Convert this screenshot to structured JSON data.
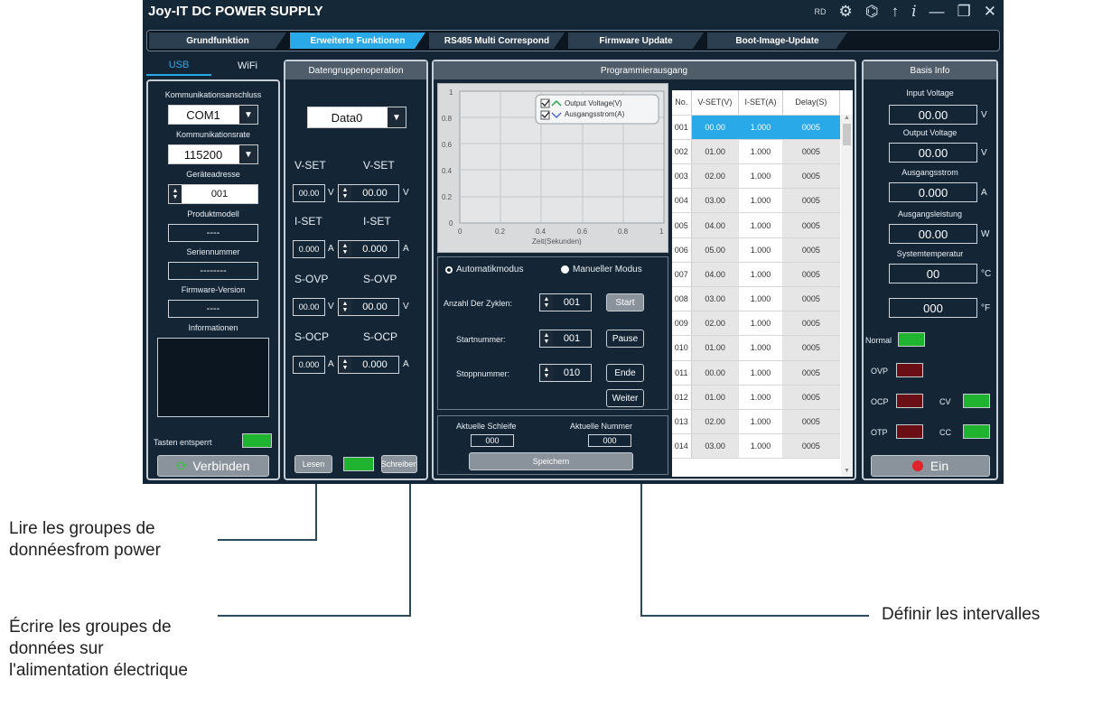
{
  "window": {
    "title": "Joy-IT DC POWER SUPPLY",
    "rd_label": "RD"
  },
  "tabs": [
    {
      "label": "Grundfunktion"
    },
    {
      "label": "Erweiterte Funktionen"
    },
    {
      "label": "RS485 Multi Correspond"
    },
    {
      "label": "Firmware Update"
    },
    {
      "label": "Boot-Image-Update"
    }
  ],
  "left": {
    "tab_usb": "USB",
    "tab_wifi": "WiFi",
    "port_label": "Kommunikationsanschluss",
    "port_value": "COM1",
    "rate_label": "Kommunikationsrate",
    "rate_value": "115200",
    "addr_label": "Geräteadresse",
    "addr_value": "001",
    "model_label": "Produktmodell",
    "model_value": "----",
    "serial_label": "Seriennummer",
    "serial_value": "--------",
    "fw_label": "Firmware-Version",
    "fw_value": "----",
    "info_label": "Informationen",
    "keys_label": "Tasten entsperrt",
    "connect_button": "Verbinden"
  },
  "group": {
    "header": "Datengruppenoperation",
    "select_value": "Data0",
    "vset_l": "V-SET",
    "vset_r": "V-SET",
    "vset_val1": "00.00",
    "vset_val2": "00.00",
    "vset_unit": "V",
    "iset_l": "I-SET",
    "iset_r": "I-SET",
    "iset_val1": "0.000",
    "iset_val2": "0.000",
    "iset_unit": "A",
    "sovp_l": "S-OVP",
    "sovp_r": "S-OVP",
    "sovp_val1": "00.00",
    "sovp_val2": "00.00",
    "sovp_unit": "V",
    "socp_l": "S-OCP",
    "socp_r": "S-OCP",
    "socp_val1": "0.000",
    "socp_val2": "0.000",
    "socp_unit": "A",
    "read_button": "Lesen",
    "write_button": "Schreiben"
  },
  "prog": {
    "header": "Programmierausgang",
    "legend_1": "Output Voltage(V)",
    "legend_2": "Ausgangsstrom(A)",
    "xlabel": "Zeit(Sekunden)",
    "x_ticks": [
      "0",
      "0.2",
      "0.4",
      "0.6",
      "0.8",
      "1"
    ],
    "y_ticks": [
      "1",
      "0.8",
      "0.6",
      "0.4",
      "0.2",
      "0"
    ],
    "mode_auto": "Automatikmodus",
    "mode_manual": "Manueller Modus",
    "cycles_label": "Anzahl Der Zyklen:",
    "cycles_value": "001",
    "start_label": "Startnummer:",
    "start_value": "001",
    "stop_label": "Stoppnummer:",
    "stop_value": "010",
    "btn_start": "Start",
    "btn_pause": "Pause",
    "btn_end": "Ende",
    "btn_next": "Weiter",
    "loop_label": "Aktuelle Schleife",
    "loop_value": "000",
    "num_label": "Aktuelle Nummer",
    "num_value": "000",
    "save_button": "Speichern",
    "table_headers": [
      "No.",
      "V-SET(V)",
      "I-SET(A)",
      "Delay(S)"
    ],
    "rows": [
      [
        "001",
        "00.00",
        "1.000",
        "0005"
      ],
      [
        "002",
        "01.00",
        "1.000",
        "0005"
      ],
      [
        "003",
        "02.00",
        "1.000",
        "0005"
      ],
      [
        "004",
        "03.00",
        "1.000",
        "0005"
      ],
      [
        "005",
        "04.00",
        "1.000",
        "0005"
      ],
      [
        "006",
        "05.00",
        "1.000",
        "0005"
      ],
      [
        "007",
        "04.00",
        "1.000",
        "0005"
      ],
      [
        "008",
        "03.00",
        "1.000",
        "0005"
      ],
      [
        "009",
        "02.00",
        "1.000",
        "0005"
      ],
      [
        "010",
        "01.00",
        "1.000",
        "0005"
      ],
      [
        "011",
        "00.00",
        "1.000",
        "0005"
      ],
      [
        "012",
        "01.00",
        "1.000",
        "0005"
      ],
      [
        "013",
        "02.00",
        "1.000",
        "0005"
      ],
      [
        "014",
        "03.00",
        "1.000",
        "0005"
      ]
    ]
  },
  "basis": {
    "header": "Basis Info",
    "in_v_label": "Input Voltage",
    "in_v_value": "00.00",
    "in_v_unit": "V",
    "out_v_label": "Output Voltage",
    "out_v_value": "00.00",
    "out_v_unit": "V",
    "out_i_label": "Ausgangsstrom",
    "out_i_value": "0.000",
    "out_i_unit": "A",
    "out_p_label": "Ausgangsleistung",
    "out_p_value": "00.00",
    "out_p_unit": "W",
    "temp_label": "Systemtemperatur",
    "temp_c_value": "00",
    "temp_c_unit": "°C",
    "temp_f_value": "000",
    "temp_f_unit": "°F",
    "normal": "Normal",
    "ovp": "OVP",
    "ocp": "OCP",
    "otp": "OTP",
    "cv": "CV",
    "cc": "CC",
    "on_button": "Ein"
  },
  "callouts": {
    "read": "Lire les groupes de donnéesfrom power",
    "write": "Écrire les groupes de données sur l'alimentation électrique",
    "interval": "Définir les intervalles"
  },
  "colors": {
    "accent": "#2aa9e8",
    "led_green": "#1fb32f",
    "led_red": "#6a0f16",
    "bg": "#142636"
  }
}
